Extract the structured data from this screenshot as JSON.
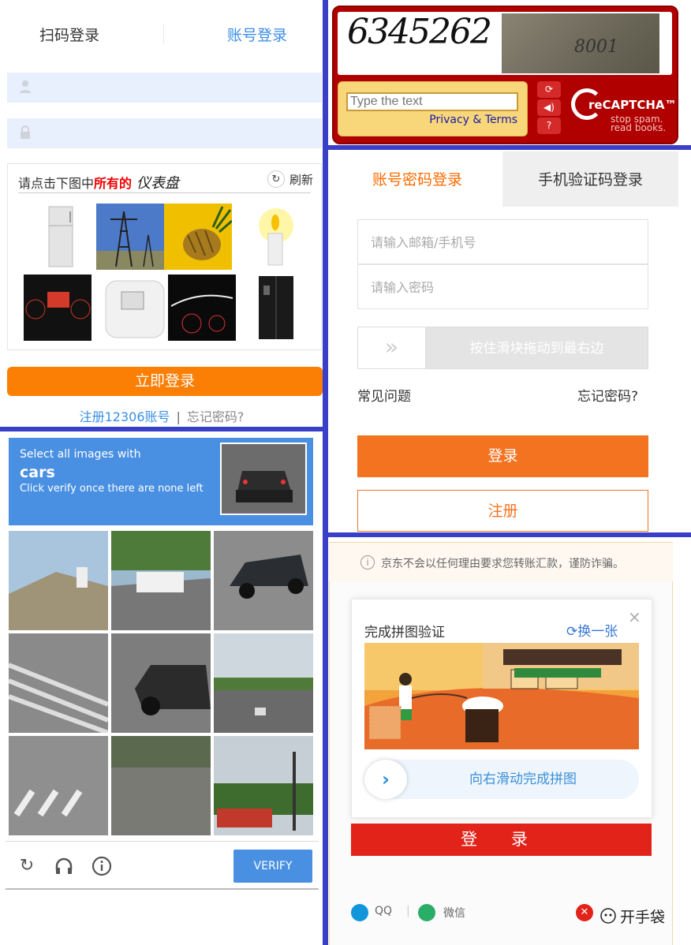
{
  "panel_12306": {
    "tab_qr": "扫码登录",
    "tab_account": "账号登录",
    "captcha_prompt_pre": "请点击下图中",
    "captcha_prompt_hl": "所有的",
    "captcha_prompt_word": "仪表盘",
    "refresh": "刷新",
    "login_button": "立即登录",
    "register_link": "注册12306账号",
    "separator": "|",
    "forgot_link": "忘记密码?",
    "accent": "#fb7f05"
  },
  "panel_recaptcha_v1": {
    "code": "6345262",
    "photo_number": "8001",
    "input_placeholder": "Type the text",
    "privacy": "Privacy & Terms",
    "brand": "reCAPTCHA™",
    "tagline_1": "stop spam.",
    "tagline_2": "read books.",
    "icons": [
      "refresh-icon",
      "audio-icon",
      "help-icon"
    ]
  },
  "panel_account": {
    "tab_password": "账号密码登录",
    "tab_sms": "手机验证码登录",
    "email_placeholder": "请输入邮箱/手机号",
    "password_placeholder": "请输入密码",
    "slider_handle": "»",
    "slider_text": "按住滑块拖动到最右边",
    "faq": "常见问题",
    "forgot": "忘记密码?",
    "login_button": "登录",
    "register_button": "注册",
    "accent": "#f37321"
  },
  "panel_recaptcha_v2": {
    "line1": "Select all images with",
    "target": "cars",
    "line3": "Click verify once there are none left",
    "verify_button": "VERIFY",
    "icons": [
      "reload-icon",
      "headphones-icon",
      "info-icon"
    ],
    "accent": "#4a90e2"
  },
  "panel_jd": {
    "notice": "京东不会以任何理由要求您转账汇款，谨防诈骗。",
    "puzzle_title": "完成拼图验证",
    "change": "换一张",
    "close": "×",
    "slide_text": "向右滑动完成拼图",
    "login_button": "登 录",
    "qq": "QQ",
    "separator": "|",
    "wechat": "微信",
    "watermark": "开手袋",
    "accent": "#e2231a"
  }
}
